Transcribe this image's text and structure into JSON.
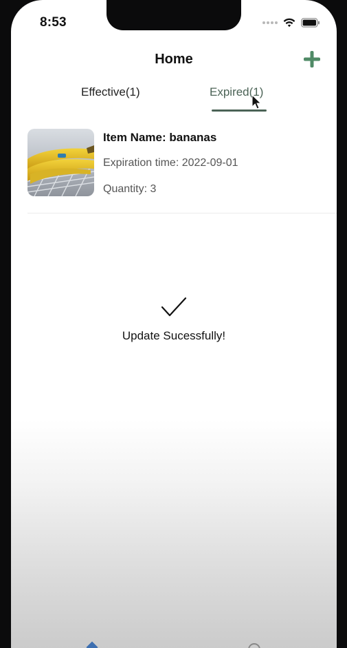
{
  "status_bar": {
    "time": "8:53"
  },
  "nav": {
    "title": "Home",
    "add_icon": "plus-icon"
  },
  "tabs": [
    {
      "label": "Effective(1)",
      "selected": false
    },
    {
      "label": "Expired(1)",
      "selected": true
    }
  ],
  "items": [
    {
      "name_line": "Item Name: bananas",
      "expiration_line": "Expiration time: 2022-09-01",
      "quantity_line": "Quantity: 3",
      "image": "bananas-photo"
    }
  ],
  "toast": {
    "icon": "checkmark-icon",
    "message": "Update Sucessfully!"
  },
  "colors": {
    "accent": "#4b6356",
    "add_button": "#4f8a66",
    "text": "#111111",
    "secondary_text": "#555555"
  }
}
